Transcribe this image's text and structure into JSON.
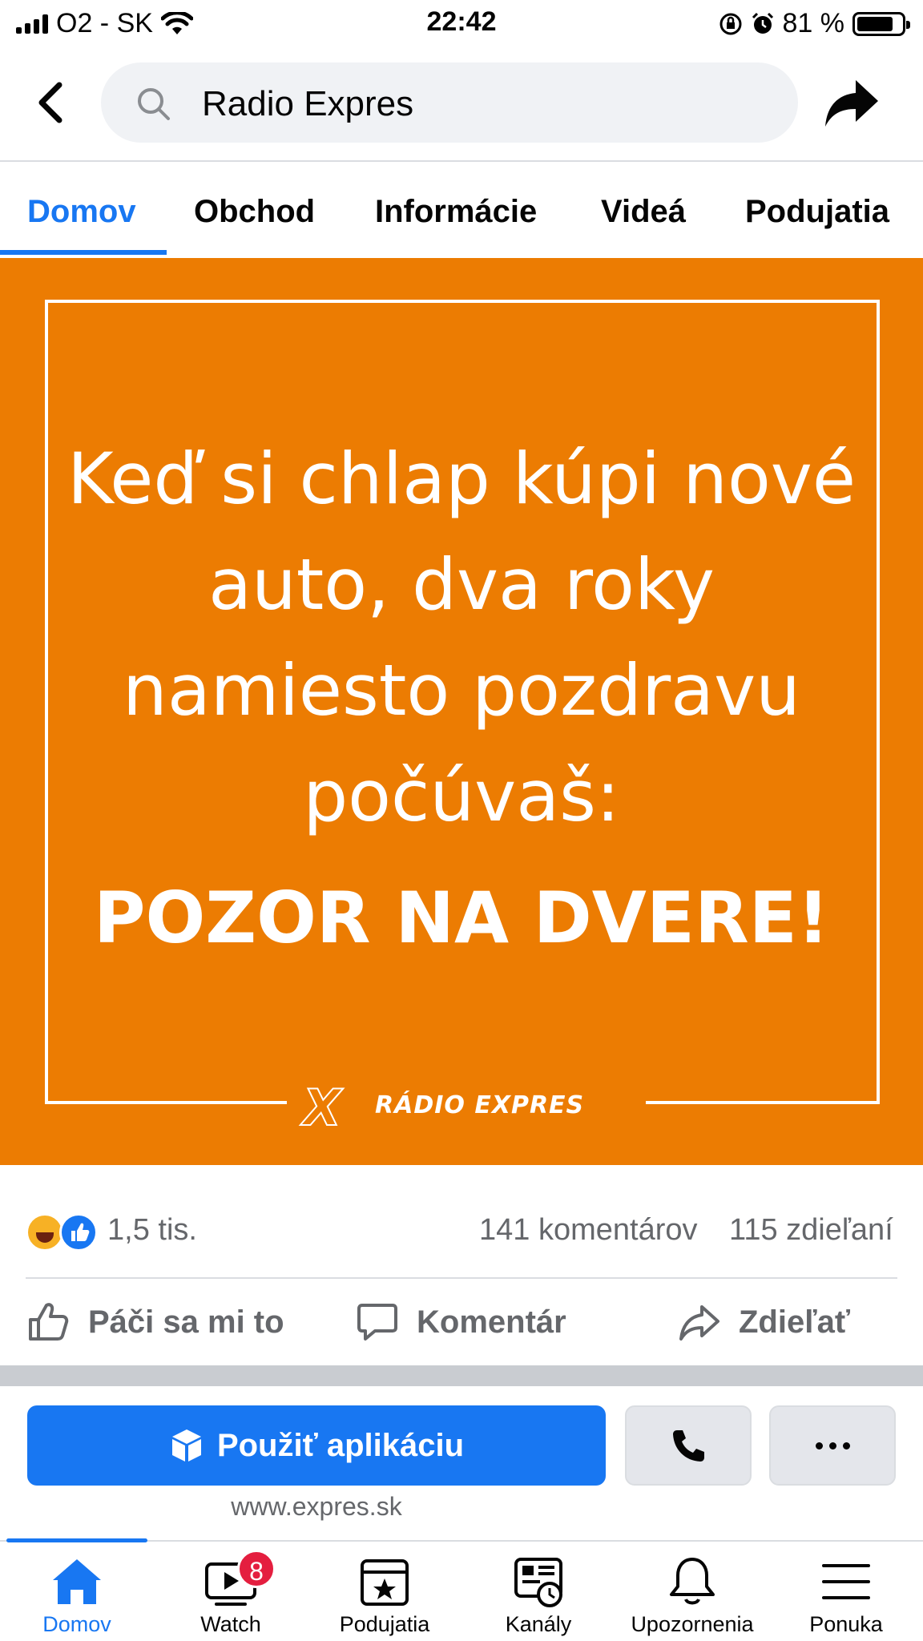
{
  "status_bar": {
    "carrier": "O2 - SK",
    "time": "22:42",
    "battery": "81 %",
    "battery_level": 0.81
  },
  "header": {
    "search_value": "Radio Expres"
  },
  "tabs": [
    {
      "label": "Domov",
      "active": true
    },
    {
      "label": "Obchod",
      "active": false
    },
    {
      "label": "Informácie",
      "active": false
    },
    {
      "label": "Videá",
      "active": false
    },
    {
      "label": "Podujatia",
      "active": false
    }
  ],
  "post": {
    "image": {
      "quote_lines": [
        "Keď si chlap kúpi nové",
        "auto, dva roky",
        "namiesto pozdravu",
        "počúvaš:"
      ],
      "quote_bold": "POZOR NA DVERE!",
      "logo_text": "RÁDIO EXPRES",
      "background_color": "#ec7c02"
    },
    "reactions_count": "1,5 tis.",
    "comments_count": "141 komentárov",
    "shares_count": "115 zdieľaní",
    "actions": {
      "like": "Páči sa mi to",
      "comment": "Komentár",
      "share": "Zdieľať"
    }
  },
  "cta": {
    "primary_label": "Použiť aplikáciu",
    "website": "www.expres.sk"
  },
  "bottom_nav": [
    {
      "label": "Domov",
      "icon": "home-icon",
      "active": true
    },
    {
      "label": "Watch",
      "icon": "watch-icon",
      "badge": "8"
    },
    {
      "label": "Podujatia",
      "icon": "events-icon"
    },
    {
      "label": "Kanály",
      "icon": "feeds-icon"
    },
    {
      "label": "Upozornenia",
      "icon": "bell-icon"
    },
    {
      "label": "Ponuka",
      "icon": "menu-icon"
    }
  ],
  "colors": {
    "accent": "#1877f2",
    "badge": "#e41e3f",
    "muted_text": "#65676b"
  }
}
